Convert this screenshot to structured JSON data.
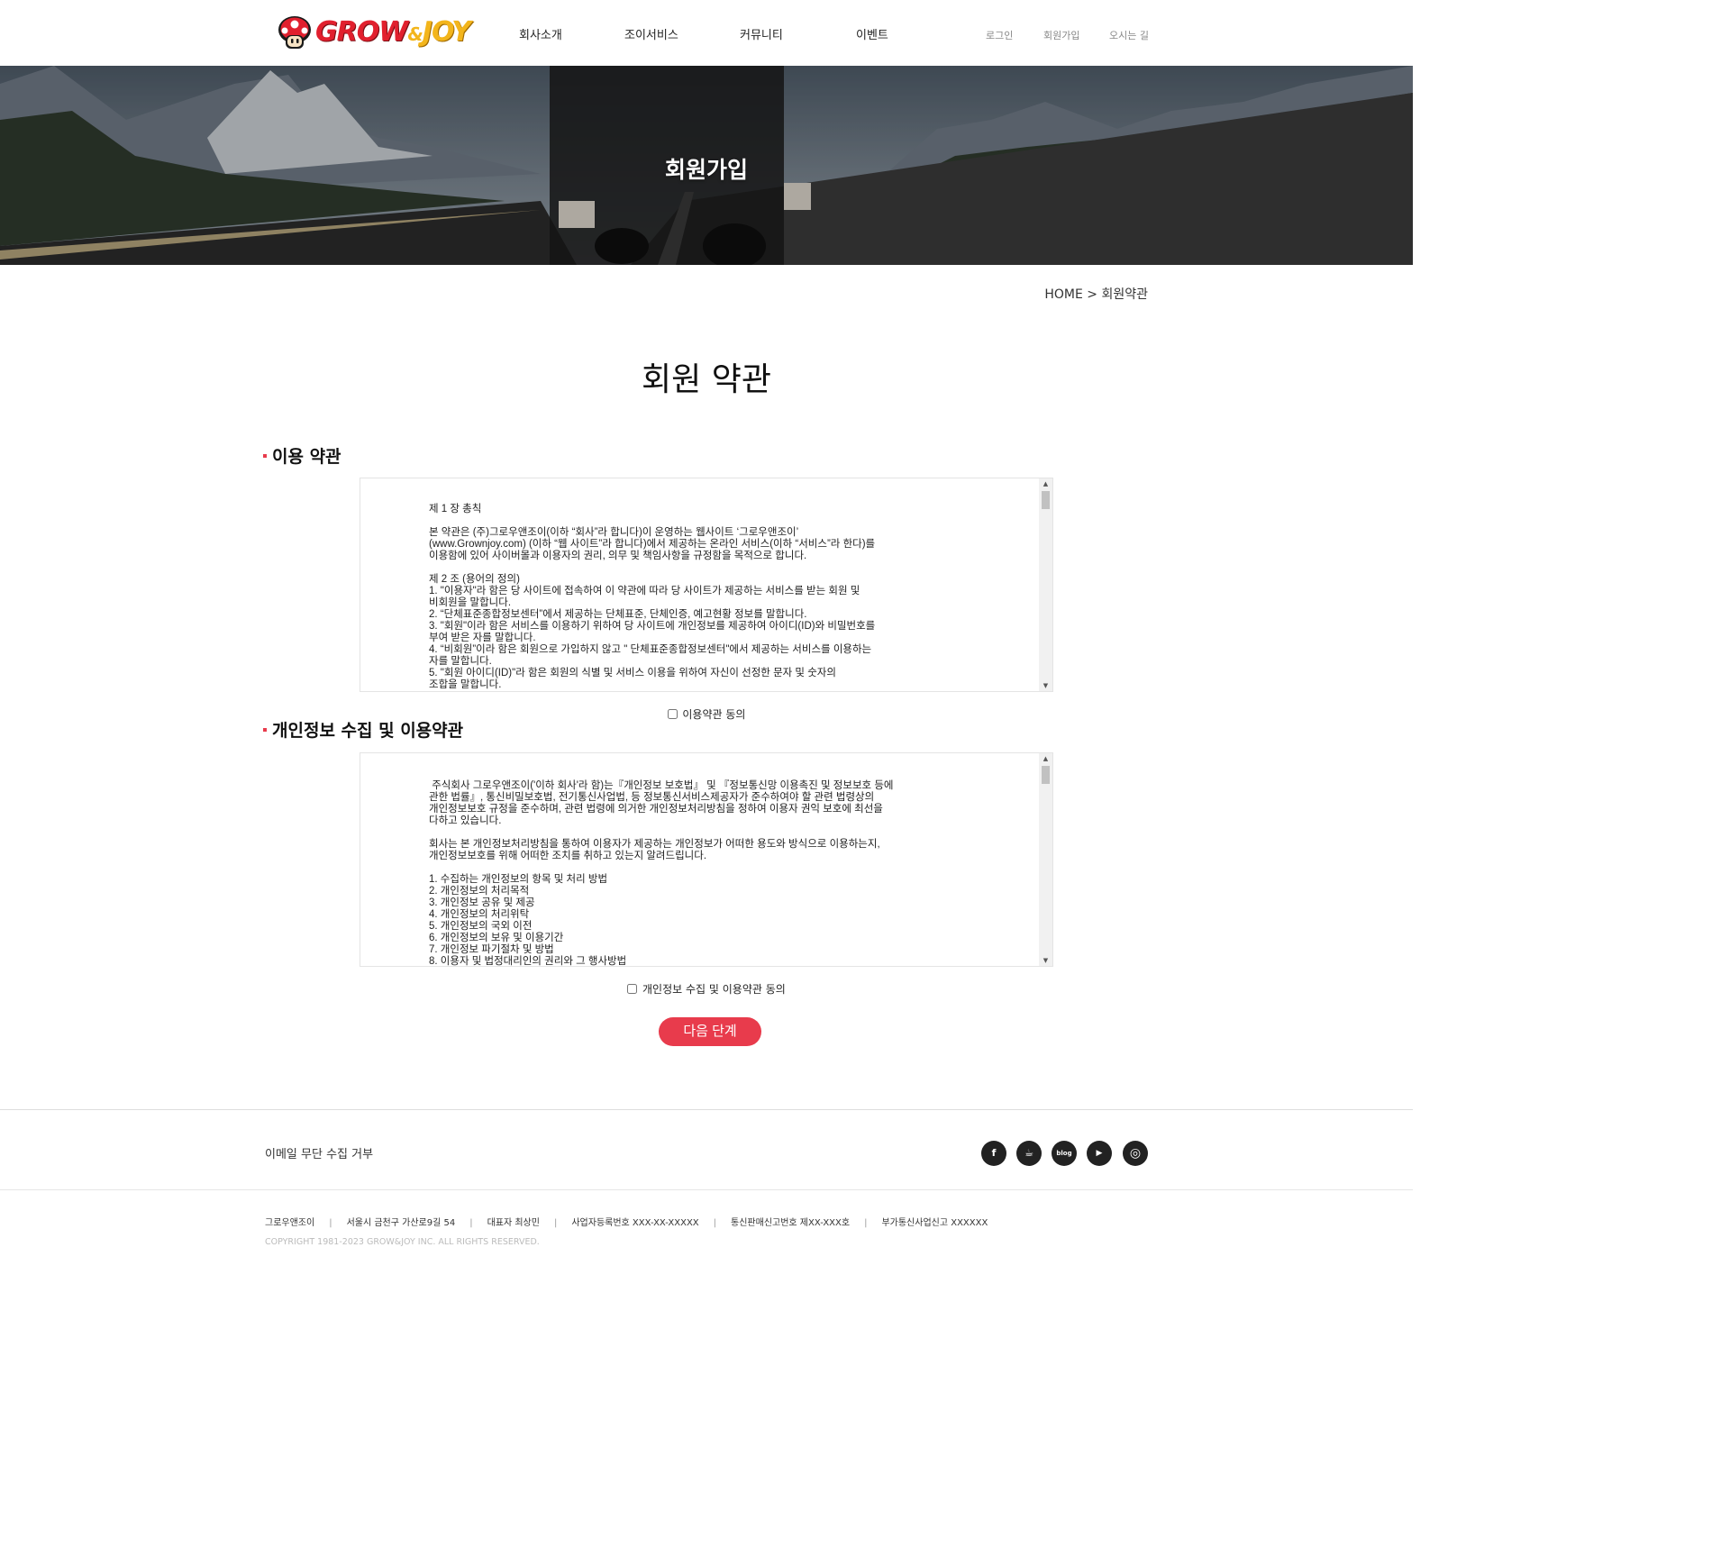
{
  "header": {
    "logo_text_grow": "GROW",
    "logo_text_amp": "&",
    "logo_text_joy": "JOY",
    "nav": [
      {
        "label": "회사소개"
      },
      {
        "label": "조이서비스"
      },
      {
        "label": "커뮤니티"
      },
      {
        "label": "이벤트"
      }
    ],
    "util": [
      {
        "label": "로그인"
      },
      {
        "label": "회원가입"
      },
      {
        "label": "오시는 길"
      }
    ]
  },
  "hero": {
    "title": "회원가입"
  },
  "breadcrumb": "HOME > 회원약관",
  "page_title": "회원 약관",
  "sections": [
    {
      "heading": "이용 약관",
      "text": "제 1 장 총칙\n\n본 약관은 (주)그로우앤조이(이하 “회사”라 합니다)이 운영하는 웹사이트 ‘그로우앤조이’\n(www.Grownjoy.com) (이하 “웹 사이트”라 합니다)에서 제공하는 온라인 서비스(이하 “서비스”라 한다)를\n이용함에 있어 사이버몰과 이용자의 권리, 의무 및 책임사항을 규정함을 목적으로 합니다.\n\n제 2 조 (용어의 정의)\n1. \"이용자\"라 함은 당 사이트에 접속하여 이 약관에 따라 당 사이트가 제공하는 서비스를 받는 회원 및\n비회원을 말합니다.\n2. “단체표준종합정보센터”에서 제공하는 단체표준, 단체인증, 예고현황 정보를 말합니다.\n3. \"회원\"이라 함은 서비스를 이용하기 위하여 당 사이트에 개인정보를 제공하여 아이디(ID)와 비밀번호를\n부여 받은 자를 말합니다.\n4. “비회원”이라 함은 회원으로 가입하지 않고 \" 단체표준종합정보센터\"에서 제공하는 서비스를 이용하는\n자를 말합니다.\n5. \"회원 아이디(ID)\"라 함은 회원의 식별 및 서비스 이용을 위하여 자신이 선정한 문자 및 숫자의\n조합을 말합니다.",
      "agree_label": "이용약관 동의"
    },
    {
      "heading": "개인정보 수집 및 이용약관",
      "text": " 주식회사 그로우앤조이('이하 회사'라 함)는『개인정보 보호법』 및 『정보통신망 이용촉진 및 정보보호 등에\n관한 법률』, 통신비밀보호법, 전기통신사업법, 등 정보통신서비스제공자가 준수하여야 할 관련 법령상의\n개인정보보호 규정을 준수하며, 관련 법령에 의거한 개인정보처리방침을 정하여 이용자 권익 보호에 최선을\n다하고 있습니다.\n\n회사는 본 개인정보처리방침을 통하여 이용자가 제공하는 개인정보가 어떠한 용도와 방식으로 이용하는지,\n개인정보보호를 위해 어떠한 조치를 취하고 있는지 알려드립니다.\n\n1. 수집하는 개인정보의 항목 및 처리 방법\n2. 개인정보의 처리목적\n3. 개인정보 공유 및 제공\n4. 개인정보의 처리위탁\n5. 개인정보의 국외 이전\n6. 개인정보의 보유 및 이용기간\n7. 개인정보 파기절차 및 방법\n8. 이용자 및 법정대리인의 권리와 그 행사방법",
      "agree_label": "개인정보 수집 및 이용약관 동의"
    }
  ],
  "next_button": "다음 단계",
  "footer": {
    "notice": "이메일 무단 수집 거부",
    "sns": [
      {
        "name": "facebook",
        "glyph": "f"
      },
      {
        "name": "kakao",
        "glyph": "☕"
      },
      {
        "name": "blog",
        "glyph": "blog"
      },
      {
        "name": "youtube",
        "glyph": "▶"
      },
      {
        "name": "instagram",
        "glyph": "◎"
      }
    ],
    "info": [
      "그로우앤조이",
      "서울시 금천구 가산로9길 54",
      "대표자 최상민",
      "사업자등록번호 XXX-XX-XXXXX",
      "통신판매신고번호 제XX-XXX호",
      "부가통신사업신고 XXXXXX"
    ],
    "copyright": "COPYRIGHT 1981-2023 GROW&JOY INC. ALL RIGHTS RESERVED."
  },
  "colors": {
    "accent": "#e83b4c",
    "logo_red": "#e1202e",
    "logo_yellow": "#f3b51b"
  }
}
